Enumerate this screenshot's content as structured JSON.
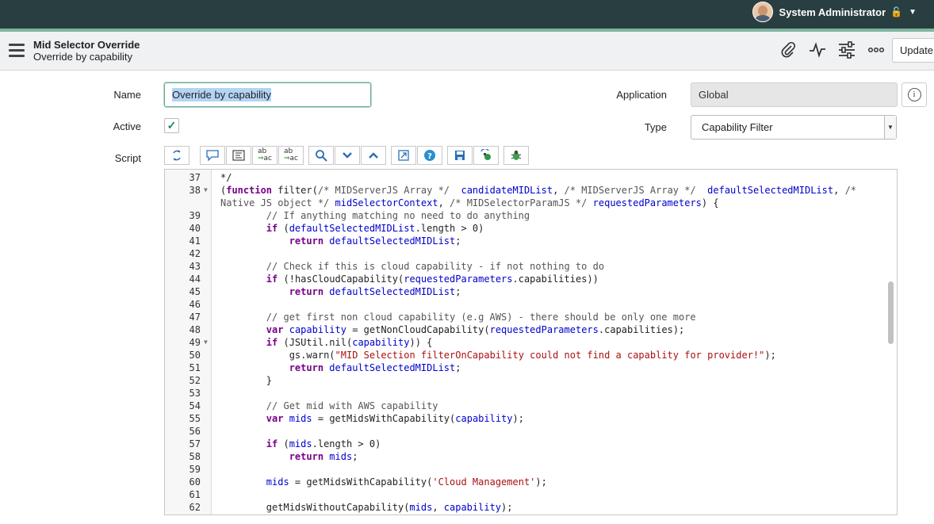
{
  "user": {
    "name": "System Administrator",
    "avatar_icon": "user-avatar",
    "lock_icon": "🔓",
    "caret": "▼"
  },
  "header": {
    "title": "Mid Selector Override",
    "subtitle": "Override by capability",
    "update_label": "Update",
    "icons": [
      "paperclip-icon",
      "activity-icon",
      "sliders-icon",
      "more-icon"
    ]
  },
  "form": {
    "name_label": "Name",
    "name_value": "Override by capability",
    "active_label": "Active",
    "active_checked": true,
    "script_label": "Script",
    "application_label": "Application",
    "application_value": "Global",
    "type_label": "Type",
    "type_value": "Capability Filter"
  },
  "toolbar": [
    "toggle-syntax",
    "comment",
    "format",
    "replace",
    "replace-all",
    "search",
    "next",
    "previous",
    "fullscreen",
    "help",
    "save",
    "script-debug",
    "bug"
  ],
  "code": [
    {
      "n": "37",
      "fold": "",
      "t": "*/"
    },
    {
      "n": "38",
      "fold": "▼",
      "t": "(function filter(/* MIDServerJS Array */  candidateMIDList, /* MIDServerJS Array */  defaultSelectedMIDList, /*"
    },
    {
      "n": "",
      "fold": "",
      "t": "Native JS object */ midSelectorContext, /* MIDSelectorParamJS */ requestedParameters) {"
    },
    {
      "n": "39",
      "fold": "",
      "t": "        // If anything matching no need to do anything"
    },
    {
      "n": "40",
      "fold": "",
      "t": "        if (defaultSelectedMIDList.length > 0)"
    },
    {
      "n": "41",
      "fold": "",
      "t": "            return defaultSelectedMIDList;"
    },
    {
      "n": "42",
      "fold": "",
      "t": ""
    },
    {
      "n": "43",
      "fold": "",
      "t": "        // Check if this is cloud capability - if not nothing to do"
    },
    {
      "n": "44",
      "fold": "",
      "t": "        if (!hasCloudCapability(requestedParameters.capabilities))"
    },
    {
      "n": "45",
      "fold": "",
      "t": "            return defaultSelectedMIDList;"
    },
    {
      "n": "46",
      "fold": "",
      "t": ""
    },
    {
      "n": "47",
      "fold": "",
      "t": "        // get first non cloud capability (e.g AWS) - there should be only one more"
    },
    {
      "n": "48",
      "fold": "",
      "t": "        var capability = getNonCloudCapability(requestedParameters.capabilities);"
    },
    {
      "n": "49",
      "fold": "▼",
      "t": "        if (JSUtil.nil(capability)) {"
    },
    {
      "n": "50",
      "fold": "",
      "t": "            gs.warn(\"MID Selection filterOnCapability could not find a capablity for provider!\");"
    },
    {
      "n": "51",
      "fold": "",
      "t": "            return defaultSelectedMIDList;"
    },
    {
      "n": "52",
      "fold": "",
      "t": "        }"
    },
    {
      "n": "53",
      "fold": "",
      "t": ""
    },
    {
      "n": "54",
      "fold": "",
      "t": "        // Get mid with AWS capability"
    },
    {
      "n": "55",
      "fold": "",
      "t": "        var mids = getMidsWithCapability(capability);"
    },
    {
      "n": "56",
      "fold": "",
      "t": ""
    },
    {
      "n": "57",
      "fold": "",
      "t": "        if (mids.length > 0)"
    },
    {
      "n": "58",
      "fold": "",
      "t": "            return mids;"
    },
    {
      "n": "59",
      "fold": "",
      "t": ""
    },
    {
      "n": "60",
      "fold": "",
      "t": "        mids = getMidsWithCapability('Cloud Management');"
    },
    {
      "n": "61",
      "fold": "",
      "t": ""
    },
    {
      "n": "62",
      "fold": "",
      "t": "        getMidsWithoutCapability(mids, capability);"
    }
  ]
}
